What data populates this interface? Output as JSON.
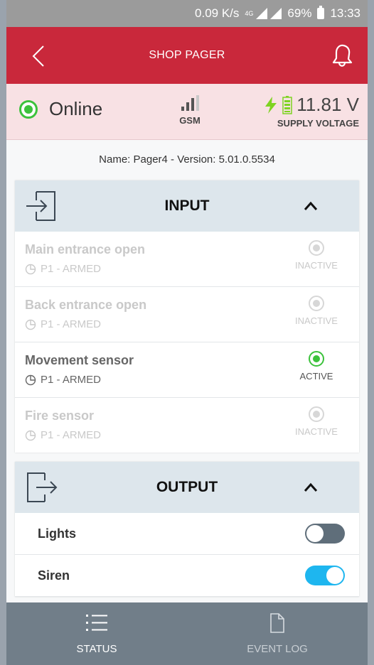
{
  "status_bar": {
    "speed": "0.09 K/s",
    "network": "4G",
    "battery": "69%",
    "time": "13:33"
  },
  "app_bar": {
    "title": "SHOP PAGER",
    "back_icon": "chevron-left-icon",
    "bell_icon": "bell-icon"
  },
  "summary": {
    "connection": "Online",
    "signal_label": "GSM",
    "signal_level": 0.75,
    "voltage": "11.81 V",
    "voltage_label": "SUPPLY VOLTAGE"
  },
  "device_info": "Name: Pager4 - Version: 5.01.0.5534",
  "input_panel": {
    "title": "INPUT",
    "items": [
      {
        "name": "Main entrance open",
        "mode": "P1 - ARMED",
        "state": "INACTIVE"
      },
      {
        "name": "Back entrance open",
        "mode": "P1 - ARMED",
        "state": "INACTIVE"
      },
      {
        "name": "Movement sensor",
        "mode": "P1 - ARMED",
        "state": "ACTIVE"
      },
      {
        "name": "Fire sensor",
        "mode": "P1 - ARMED",
        "state": "INACTIVE"
      }
    ]
  },
  "output_panel": {
    "title": "OUTPUT",
    "items": [
      {
        "name": "Lights",
        "on": false
      },
      {
        "name": "Siren",
        "on": true
      }
    ]
  },
  "bottom_nav": {
    "items": [
      {
        "label": "STATUS",
        "icon": "list-icon",
        "selected": true
      },
      {
        "label": "EVENT LOG",
        "icon": "document-icon",
        "selected": false
      }
    ]
  },
  "colors": {
    "brand_red": "#c9283b",
    "online_green": "#3cc23c",
    "toggle_on": "#1eb6ef",
    "nav_bg": "#717e89"
  }
}
